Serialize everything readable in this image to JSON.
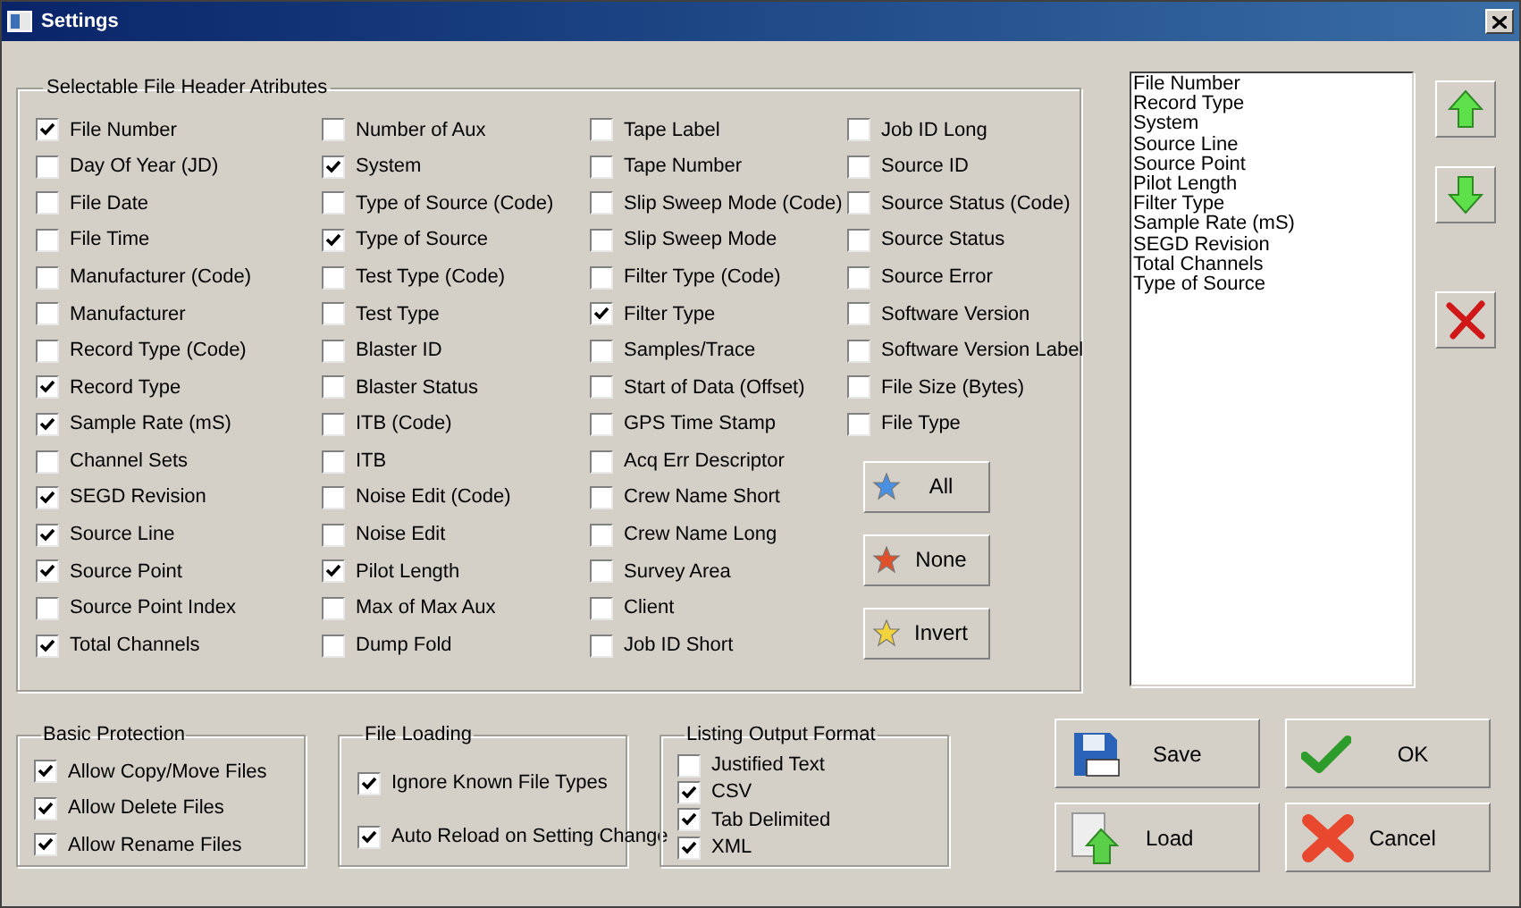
{
  "window": {
    "title": "Settings"
  },
  "header_attributes": {
    "title": "Selectable File Header Atributes",
    "columns": [
      [
        {
          "label": "File Number",
          "checked": true
        },
        {
          "label": "Day Of Year (JD)",
          "checked": false
        },
        {
          "label": "File Date",
          "checked": false
        },
        {
          "label": "File Time",
          "checked": false
        },
        {
          "label": "Manufacturer (Code)",
          "checked": false
        },
        {
          "label": "Manufacturer",
          "checked": false
        },
        {
          "label": "Record Type (Code)",
          "checked": false
        },
        {
          "label": "Record Type",
          "checked": true
        },
        {
          "label": "Sample Rate (mS)",
          "checked": true
        },
        {
          "label": "Channel Sets",
          "checked": false
        },
        {
          "label": "SEGD Revision",
          "checked": true
        },
        {
          "label": "Source Line",
          "checked": true
        },
        {
          "label": "Source Point",
          "checked": true
        },
        {
          "label": "Source Point Index",
          "checked": false
        },
        {
          "label": "Total Channels",
          "checked": true
        }
      ],
      [
        {
          "label": "Number of Aux",
          "checked": false
        },
        {
          "label": "System",
          "checked": true
        },
        {
          "label": "Type of Source (Code)",
          "checked": false
        },
        {
          "label": "Type of Source",
          "checked": true
        },
        {
          "label": "Test Type (Code)",
          "checked": false
        },
        {
          "label": "Test Type",
          "checked": false
        },
        {
          "label": "Blaster ID",
          "checked": false
        },
        {
          "label": "Blaster Status",
          "checked": false
        },
        {
          "label": "ITB (Code)",
          "checked": false
        },
        {
          "label": "ITB",
          "checked": false
        },
        {
          "label": "Noise Edit (Code)",
          "checked": false
        },
        {
          "label": "Noise Edit",
          "checked": false
        },
        {
          "label": "Pilot Length",
          "checked": true
        },
        {
          "label": "Max of Max Aux",
          "checked": false
        },
        {
          "label": "Dump Fold",
          "checked": false
        }
      ],
      [
        {
          "label": "Tape Label",
          "checked": false
        },
        {
          "label": "Tape Number",
          "checked": false
        },
        {
          "label": "Slip Sweep Mode (Code)",
          "checked": false
        },
        {
          "label": "Slip Sweep Mode",
          "checked": false
        },
        {
          "label": "Filter Type (Code)",
          "checked": false
        },
        {
          "label": "Filter Type",
          "checked": true
        },
        {
          "label": "Samples/Trace",
          "checked": false
        },
        {
          "label": "Start of Data (Offset)",
          "checked": false
        },
        {
          "label": "GPS Time Stamp",
          "checked": false
        },
        {
          "label": "Acq Err Descriptor",
          "checked": false
        },
        {
          "label": "Crew Name Short",
          "checked": false
        },
        {
          "label": "Crew Name Long",
          "checked": false
        },
        {
          "label": "Survey Area",
          "checked": false
        },
        {
          "label": "Client",
          "checked": false
        },
        {
          "label": "Job ID Short",
          "checked": false
        }
      ],
      [
        {
          "label": "Job ID Long",
          "checked": false
        },
        {
          "label": "Source ID",
          "checked": false
        },
        {
          "label": "Source Status (Code)",
          "checked": false
        },
        {
          "label": "Source Status",
          "checked": false
        },
        {
          "label": "Source Error",
          "checked": false
        },
        {
          "label": "Software Version",
          "checked": false
        },
        {
          "label": "Software Version Label",
          "checked": false
        },
        {
          "label": "File Size (Bytes)",
          "checked": false
        },
        {
          "label": "File Type",
          "checked": false
        }
      ]
    ],
    "select_buttons": [
      {
        "label": "All",
        "kind": "all"
      },
      {
        "label": "None",
        "kind": "none"
      },
      {
        "label": "Invert",
        "kind": "invert"
      }
    ]
  },
  "selected_list": {
    "items": [
      "File Number",
      "Record Type",
      "System",
      "Source Line",
      "Source Point",
      "Pilot Length",
      "Filter Type",
      "Sample Rate (mS)",
      "SEGD Revision",
      "Total Channels",
      "Type of Source"
    ]
  },
  "order_buttons": [
    {
      "kind": "up"
    },
    {
      "kind": "down"
    },
    {
      "kind": "remove"
    }
  ],
  "groups": [
    {
      "title": "Basic Protection",
      "kind": "compact",
      "options": [
        {
          "label": "Allow Copy/Move Files",
          "checked": true
        },
        {
          "label": "Allow Delete Files",
          "checked": true
        },
        {
          "label": "Allow Rename Files",
          "checked": true
        }
      ]
    },
    {
      "title": "File Loading",
      "kind": "spaced",
      "options": [
        {
          "label": "Ignore Known File Types",
          "checked": true
        },
        {
          "label": "Auto Reload on Setting Change",
          "checked": true
        }
      ]
    },
    {
      "title": "Listing Output Format",
      "kind": "tight",
      "options": [
        {
          "label": "Justified Text",
          "checked": false
        },
        {
          "label": "CSV",
          "checked": true
        },
        {
          "label": "Tab Delimited",
          "checked": true
        },
        {
          "label": "XML",
          "checked": true
        }
      ]
    }
  ],
  "action_buttons": [
    {
      "label": "Save",
      "kind": "save"
    },
    {
      "label": "OK",
      "kind": "ok"
    },
    {
      "label": "Load",
      "kind": "load"
    },
    {
      "label": "Cancel",
      "kind": "cancel"
    }
  ]
}
